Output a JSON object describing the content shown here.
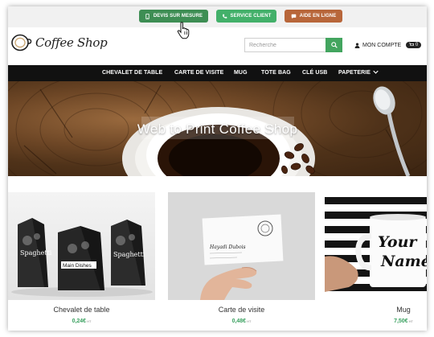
{
  "topbar": {
    "devis_label": "DEVIS SUR MESURE",
    "service_label": "SERVICE CLIENT",
    "aide_label": "AIDE EN LIGNE"
  },
  "header": {
    "logo_text": "Coffee Shop",
    "search_placeholder": "Recherche",
    "account_label": "MON COMPTE",
    "cart_count": "0"
  },
  "nav": {
    "items": [
      "CHEVALET DE TABLE",
      "CARTE DE VISITE",
      "MUG",
      "TOTE BAG",
      "CLÉ USB",
      "PAPETERIE"
    ]
  },
  "hero": {
    "title": "Web to Print Coffee Shop"
  },
  "products": [
    {
      "name": "Chevalet de table",
      "price": "0,24€",
      "price_suffix": "HT"
    },
    {
      "name": "Carte de visite",
      "price": "0,48€",
      "price_suffix": "HT"
    },
    {
      "name": "Mug",
      "price": "7,50€",
      "price_suffix": "HT"
    }
  ],
  "product_images": {
    "chevalet_text": "Spaghetti",
    "chevalet_text_2": "Main Dishes",
    "card_name": "Hayadi Dubois",
    "mug_text_1": "Your",
    "mug_text_2": "Name"
  },
  "colors": {
    "devis": "#3e8e54",
    "service": "#43b06a",
    "aide": "#b8663a",
    "price_green": "#3aa160",
    "nav_bg": "#111111"
  },
  "icons": {
    "devis": "phone-icon",
    "service": "phone-handset-icon",
    "aide": "chat-icon",
    "search": "search-icon",
    "account": "user-icon",
    "cart": "cart-icon",
    "papeterie": "chevron-down-icon",
    "pointer": "hand-pointer-icon"
  }
}
